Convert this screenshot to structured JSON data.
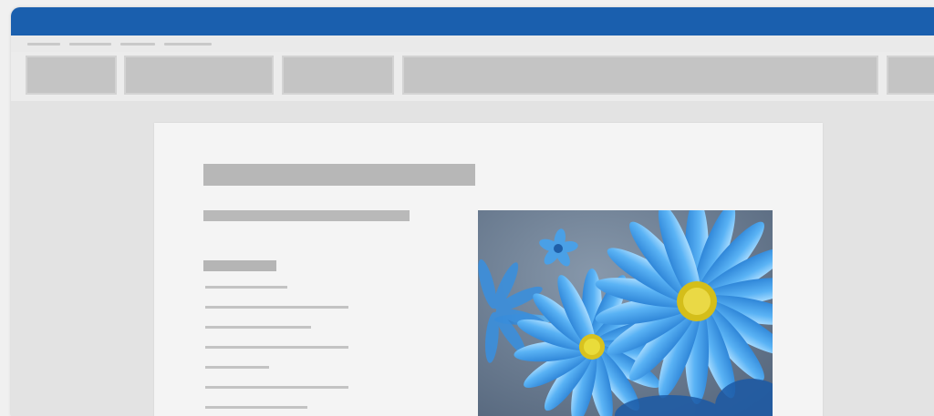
{
  "colors": {
    "title_bar": "#1a5fae",
    "window_bg": "#e7e7e7",
    "page_bg": "#f4f4f4",
    "placeholder": "#b9b9b9",
    "flower_petal": "#3d9be6",
    "flower_center": "#e2d12a",
    "photo_bg": "#6d7e93"
  },
  "icons": {
    "photo": "blue-daisy-photo"
  }
}
